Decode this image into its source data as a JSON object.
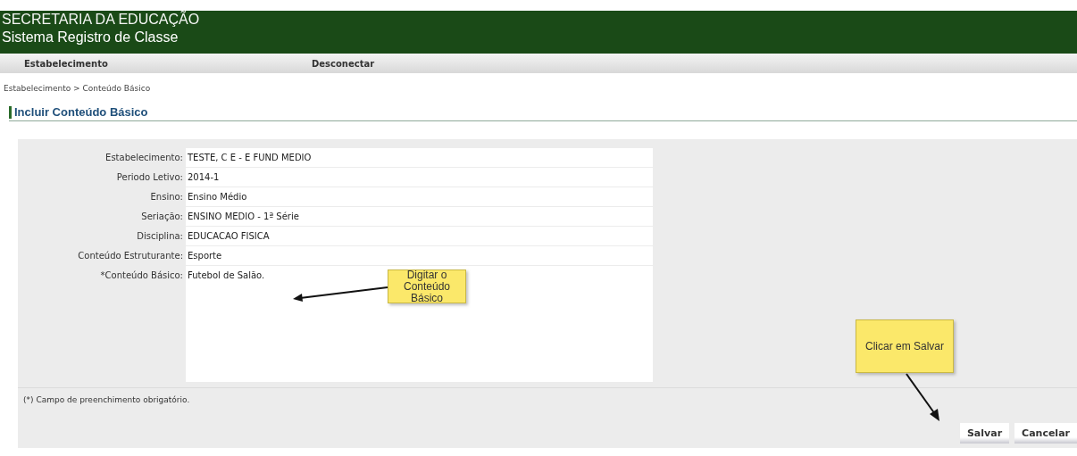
{
  "header": {
    "line_1": "SECRETARIA DA EDUCAÇÃO",
    "line_2": "Sistema Registro de Classe"
  },
  "menu": [
    {
      "label": "Estabelecimento"
    },
    {
      "label": "Desconectar"
    }
  ],
  "breadcrumb": "Estabelecimento > Conteúdo Básico",
  "page_title": "Incluir Conteúdo Básico",
  "form": {
    "fields": [
      {
        "label": "Estabelecimento:",
        "value": "TESTE, C E - E FUND MEDIO",
        "kind": "line"
      },
      {
        "label": "Periodo Letivo:",
        "value": "2014-1",
        "kind": "line"
      },
      {
        "label": "Ensino:",
        "value": "Ensino Médio",
        "kind": "line"
      },
      {
        "label": "Seriação:",
        "value": "ENSINO MEDIO - 1ª Série",
        "kind": "line"
      },
      {
        "label": "Disciplina:",
        "value": "EDUCACAO FISICA",
        "kind": "line"
      },
      {
        "label": "Conteúdo Estruturante:",
        "value": "Esporte",
        "kind": "line"
      },
      {
        "label": "*Conteúdo Básico:",
        "value": "Futebol de Salão.",
        "kind": "textarea"
      }
    ],
    "note": "(*) Campo de preenchimento obrigatório.",
    "buttons": [
      "Salvar",
      "Cancelar"
    ]
  },
  "callouts": [
    {
      "text": "Digitar o Conteúdo Básico"
    },
    {
      "text": "Clicar em Salvar"
    }
  ]
}
